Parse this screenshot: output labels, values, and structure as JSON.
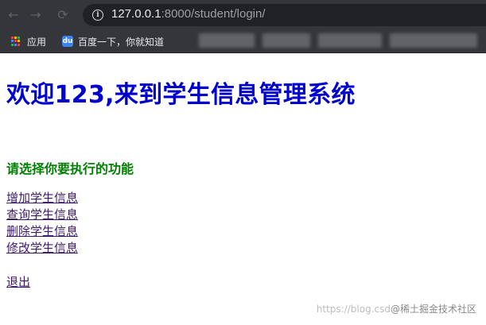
{
  "browser": {
    "url_host": "127.0.0.1",
    "url_path": ":8000/student/login/",
    "bookmarks": [
      {
        "label": "应用",
        "icon": "apps-grid-icon"
      },
      {
        "label": "百度一下，你就知道",
        "icon": "baidu-paw-icon"
      }
    ]
  },
  "page": {
    "welcome_heading": "欢迎123,来到学生信息管理系统",
    "prompt_heading": "请选择你要执行的功能",
    "links": [
      "增加学生信息",
      "查询学生信息",
      "删除学生信息",
      "修改学生信息"
    ],
    "logout_label": "退出"
  },
  "watermark": {
    "left": "https://blog.csd",
    "right": "@稀土掘金技术社区"
  },
  "colors": {
    "welcome": "#0000cc",
    "prompt": "#008000",
    "link": "#3c1a6e",
    "chrome": "#35363a"
  }
}
